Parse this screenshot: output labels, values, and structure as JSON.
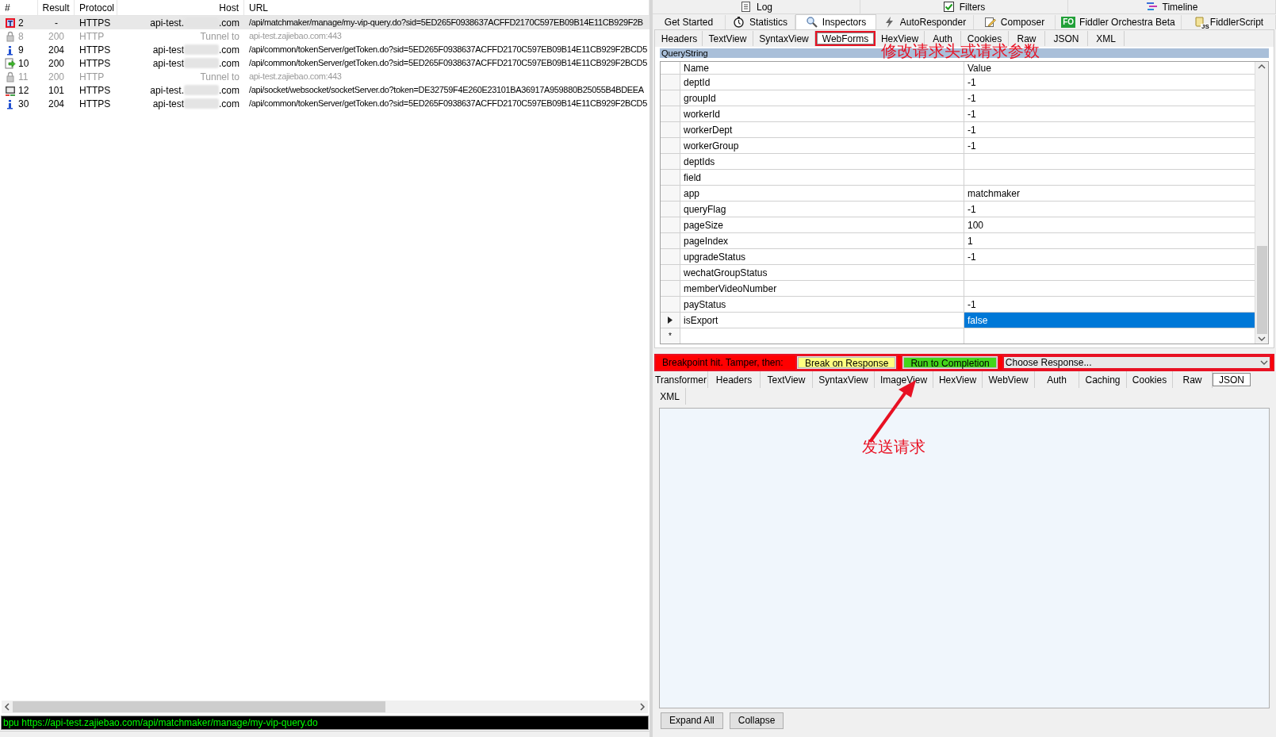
{
  "sessions": {
    "columns": [
      "#",
      "Result",
      "Protocol",
      "Host",
      "URL"
    ],
    "rows": [
      {
        "kind": "breakpoint",
        "number": "2",
        "result": "-",
        "protocol": "HTTPS",
        "host_start": "api-test.",
        "host_end": ".com",
        "host_blurred": true,
        "url": "/api/matchmaker/manage/my-vip-query.do?sid=5ED265F0938637ACFFD2170C597EB09B14E11CB929F2B",
        "selected": true,
        "dimmed": false
      },
      {
        "kind": "lock",
        "number": "8",
        "result": "200",
        "protocol": "HTTP",
        "host_start": "Tunnel to",
        "host_end": "",
        "host_blurred": false,
        "url": "api-test.zajiebao.com:443",
        "selected": false,
        "dimmed": true
      },
      {
        "kind": "info",
        "number": "9",
        "result": "204",
        "protocol": "HTTPS",
        "host_start": "api-test",
        "host_end": ".com",
        "host_blurred": true,
        "url": "/api/common/tokenServer/getToken.do?sid=5ED265F0938637ACFFD2170C597EB09B14E11CB929F2BCD5",
        "selected": false,
        "dimmed": false
      },
      {
        "kind": "response",
        "number": "10",
        "result": "200",
        "protocol": "HTTPS",
        "host_start": "api-test",
        "host_end": ".com",
        "host_blurred": true,
        "url": "/api/common/tokenServer/getToken.do?sid=5ED265F0938637ACFFD2170C597EB09B14E11CB929F2BCD5",
        "selected": false,
        "dimmed": false
      },
      {
        "kind": "lock",
        "number": "11",
        "result": "200",
        "protocol": "HTTP",
        "host_start": "Tunnel to",
        "host_end": "",
        "host_blurred": false,
        "url": "api-test.zajiebao.com:443",
        "selected": false,
        "dimmed": true
      },
      {
        "kind": "websocket",
        "number": "12",
        "result": "101",
        "protocol": "HTTPS",
        "host_start": "api-test.",
        "host_end": ".com",
        "host_blurred": true,
        "url": "/api/socket/websocket/socketServer.do?token=DE32759F4E260E23101BA36917A959880B25055B4BDEEA",
        "selected": false,
        "dimmed": false
      },
      {
        "kind": "info",
        "number": "30",
        "result": "204",
        "protocol": "HTTPS",
        "host_start": "api-test",
        "host_end": ".com",
        "host_blurred": true,
        "url": "/api/common/tokenServer/getToken.do?sid=5ED265F0938637ACFFD2170C597EB09B14E11CB929F2BCD5",
        "selected": false,
        "dimmed": false
      }
    ]
  },
  "command_line": "bpu https://api-test.zajiebao.com/api/matchmaker/manage/my-vip-query.do",
  "top_tabs": [
    {
      "label": "Log",
      "kind": "log"
    },
    {
      "label": "Filters",
      "kind": "checkbox",
      "checked": true
    },
    {
      "label": "Timeline",
      "kind": "timeline"
    }
  ],
  "main_tabs": [
    {
      "label": "Get Started",
      "kind": "plain",
      "selected": false
    },
    {
      "label": "Statistics",
      "kind": "stopwatch",
      "selected": false
    },
    {
      "label": "Inspectors",
      "kind": "magnifier",
      "selected": true
    },
    {
      "label": "AutoResponder",
      "kind": "lightning",
      "selected": false
    },
    {
      "label": "Composer",
      "kind": "pencil",
      "selected": false
    },
    {
      "label": "Fiddler Orchestra Beta",
      "kind": "badge",
      "icon_text": "FO",
      "selected": false
    },
    {
      "label": "FiddlerScript",
      "kind": "scroll",
      "icon_text": "JS",
      "selected": false
    }
  ],
  "request_tabs": [
    {
      "label": "Headers",
      "selected": false
    },
    {
      "label": "TextView",
      "selected": false
    },
    {
      "label": "SyntaxView",
      "selected": false
    },
    {
      "label": "WebForms",
      "selected": true
    },
    {
      "label": "HexView",
      "selected": false
    },
    {
      "label": "Auth",
      "selected": false
    },
    {
      "label": "Cookies",
      "selected": false
    },
    {
      "label": "Raw",
      "selected": false
    },
    {
      "label": "JSON",
      "selected": false
    },
    {
      "label": "XML",
      "selected": false
    }
  ],
  "querystring": {
    "title": "QueryString",
    "columns": [
      "Name",
      "Value"
    ],
    "rows": [
      {
        "name": "deptId",
        "value": "-1",
        "selected": false
      },
      {
        "name": "groupId",
        "value": "-1",
        "selected": false
      },
      {
        "name": "workerId",
        "value": "-1",
        "selected": false
      },
      {
        "name": "workerDept",
        "value": "-1",
        "selected": false
      },
      {
        "name": "workerGroup",
        "value": "-1",
        "selected": false
      },
      {
        "name": "deptIds",
        "value": "",
        "selected": false
      },
      {
        "name": "field",
        "value": "",
        "selected": false
      },
      {
        "name": "app",
        "value": "matchmaker",
        "selected": false
      },
      {
        "name": "queryFlag",
        "value": "-1",
        "selected": false
      },
      {
        "name": "pageSize",
        "value": "100",
        "selected": false
      },
      {
        "name": "pageIndex",
        "value": "1",
        "selected": false
      },
      {
        "name": "upgradeStatus",
        "value": "-1",
        "selected": false
      },
      {
        "name": "wechatGroupStatus",
        "value": "",
        "selected": false
      },
      {
        "name": "memberVideoNumber",
        "value": "",
        "selected": false
      },
      {
        "name": "payStatus",
        "value": "-1",
        "selected": false
      },
      {
        "name": "isExport",
        "value": "false",
        "selected": true
      }
    ],
    "new_row_marker": "*"
  },
  "breakpoint_bar": {
    "message": "Breakpoint hit. Tamper, then:",
    "buttons": [
      "Break on Response",
      "Run to Completion"
    ],
    "response_choice": "Choose Response..."
  },
  "response_tabs": [
    {
      "label": "Transformer",
      "selected": false
    },
    {
      "label": "Headers",
      "selected": false
    },
    {
      "label": "TextView",
      "selected": false
    },
    {
      "label": "SyntaxView",
      "selected": false
    },
    {
      "label": "ImageView",
      "selected": false
    },
    {
      "label": "HexView",
      "selected": false
    },
    {
      "label": "WebView",
      "selected": false
    },
    {
      "label": "Auth",
      "selected": false
    },
    {
      "label": "Caching",
      "selected": false
    },
    {
      "label": "Cookies",
      "selected": false
    },
    {
      "label": "Raw",
      "selected": false
    },
    {
      "label": "JSON",
      "selected": true
    },
    {
      "label": "XML",
      "selected": false
    }
  ],
  "response_buttons": [
    "Expand All",
    "Collapse"
  ],
  "annotations": [
    {
      "kind": "label",
      "text": "修改请求头或请求参数"
    },
    {
      "kind": "arrow",
      "text": "发送请求"
    }
  ]
}
